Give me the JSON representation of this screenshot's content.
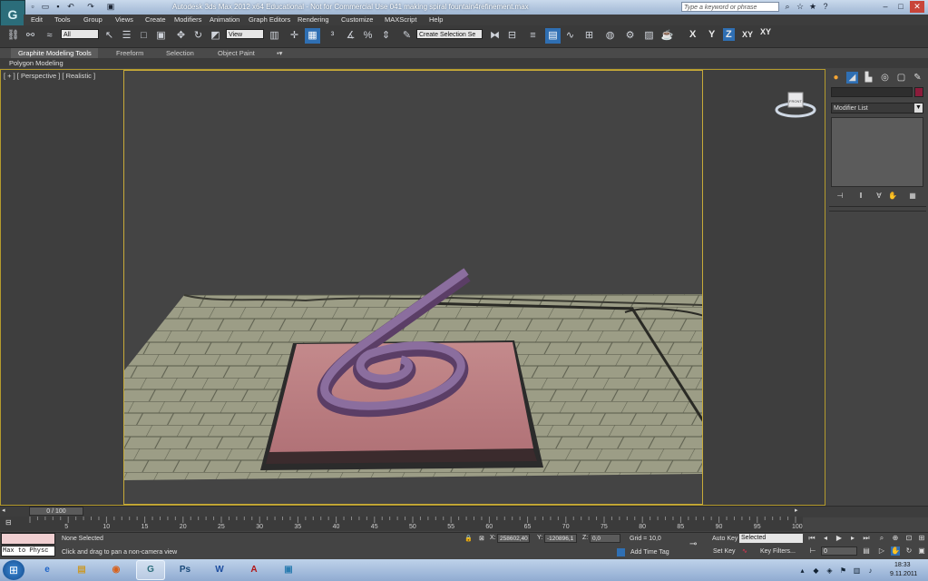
{
  "titlebar": {
    "title": "Autodesk 3ds Max  2012 x64   Educational - Not for Commercial Use    041 making spiral fountain4refinement.max",
    "search_placeholder": "Type a keyword or phrase",
    "app_logo_glyph": "G",
    "quick_access_icons": [
      "new-icon",
      "open-icon",
      "save-icon",
      "undo-icon",
      "redo-icon",
      "project-icon"
    ],
    "window_buttons": [
      "minimize-icon",
      "maximize-icon",
      "close-icon"
    ]
  },
  "menu": [
    "Edit",
    "Tools",
    "Group",
    "Views",
    "Create",
    "Modifiers",
    "Animation",
    "Graph Editors",
    "Rendering",
    "Customize",
    "MAXScript",
    "Help"
  ],
  "toolbar": {
    "selection_filter": "All",
    "ref_coord": "View",
    "named_selection": "Create Selection Se",
    "axis_x": "X",
    "axis_y": "Y",
    "axis_z": "Z",
    "axis_xy": "XY",
    "axis_xy2": "XY"
  },
  "ribbon": {
    "tabs": [
      "Graphite Modeling Tools",
      "Freeform",
      "Selection",
      "Object Paint"
    ],
    "sub_label": "Polygon Modeling"
  },
  "viewport": {
    "label": "[ + ] [ Perspective ] [ Realistic ]",
    "viewcube_label": "FRONT"
  },
  "command_panel": {
    "modifier_list": "Modifier List",
    "object_color": "#8b1c3b"
  },
  "timeline": {
    "slider_label": "0 / 100",
    "ticks": [
      "0",
      "5",
      "10",
      "15",
      "20",
      "25",
      "30",
      "35",
      "40",
      "45",
      "50",
      "55",
      "60",
      "65",
      "70",
      "75",
      "80",
      "85",
      "90",
      "95",
      "100"
    ]
  },
  "status": {
    "listener_text": "Max to Physc",
    "selection_status": "None Selected",
    "prompt": "Click and drag to pan a non-camera view",
    "x_label": "X:",
    "x_value": "258602,40",
    "y_label": "Y:",
    "y_value": "-120896,1",
    "z_label": "Z:",
    "z_value": "0,0",
    "grid": "Grid = 10,0",
    "add_time_tag": "Add Time Tag",
    "auto_key": "Auto Key",
    "set_key": "Set Key",
    "selected_dropdown": "Selected",
    "key_filters": "Key Filters...",
    "frame_value": "0"
  },
  "taskbar": {
    "time": "18:33",
    "date": "9.11.2011",
    "apps": [
      {
        "name": "ie",
        "glyph": "e",
        "color": "#1e64c8"
      },
      {
        "name": "explorer",
        "glyph": "▤",
        "color": "#c99a2e"
      },
      {
        "name": "firefox",
        "glyph": "◉",
        "color": "#d8611c"
      },
      {
        "name": "3dsmax",
        "glyph": "G",
        "color": "#2b6d7a"
      },
      {
        "name": "photoshop",
        "glyph": "Ps",
        "color": "#1a4a7a"
      },
      {
        "name": "word",
        "glyph": "W",
        "color": "#1f4fa0"
      },
      {
        "name": "acrobat",
        "glyph": "A",
        "color": "#b21515"
      },
      {
        "name": "media",
        "glyph": "▣",
        "color": "#2a7cb0"
      }
    ]
  }
}
